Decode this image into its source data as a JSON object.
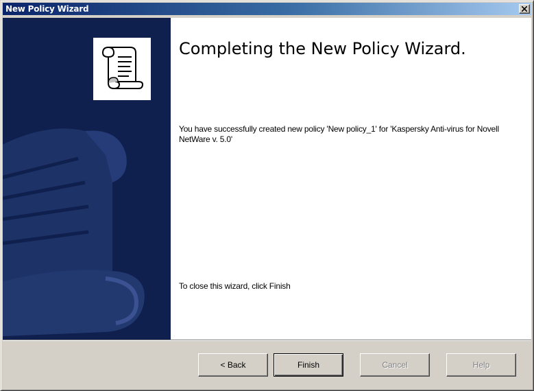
{
  "window": {
    "title": "New Policy Wizard"
  },
  "wizard": {
    "heading": "Completing the New Policy Wizard.",
    "message": "You have successfully created new policy 'New policy_1' for 'Kaspersky Anti-virus for Novell NetWare v. 5.0'",
    "close_hint": "To close this wizard, click Finish"
  },
  "buttons": {
    "back": "< Back",
    "finish": "Finish",
    "cancel": "Cancel",
    "help": "Help"
  },
  "colors": {
    "title_bar_start": "#0a246a",
    "title_bar_end": "#a6caf0",
    "side_panel": "#0f1f4e",
    "dialog_face": "#d4d0c8"
  },
  "icons": {
    "wizard_banner": "scroll-icon",
    "close": "close-icon"
  }
}
